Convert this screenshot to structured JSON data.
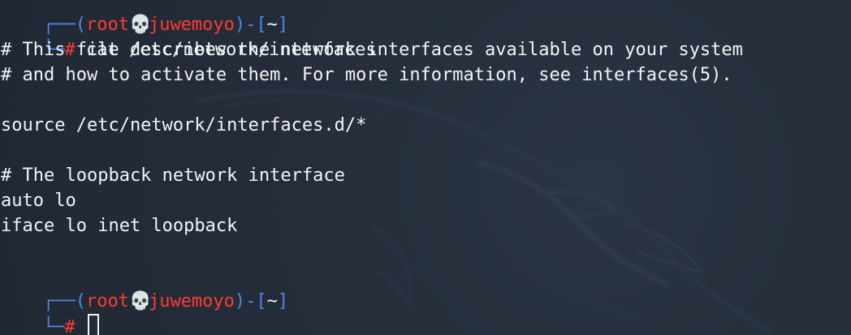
{
  "terminal": {
    "prompt_user": "root",
    "prompt_skull": "💀",
    "prompt_host": "juwemoyo",
    "prompt_path": "~",
    "prompt_hash": "#",
    "prompt_open": "┌──(",
    "prompt_close": ")-[",
    "prompt_end": "]",
    "prompt_corner_bottom": "└─",
    "command": "cat /etc/network/interfaces",
    "lines": [
      "# This file describes the network interfaces available on your system",
      "# and how to activate them. For more information, see interfaces(5).",
      "",
      "source /etc/network/interfaces.d/*",
      "",
      "# The loopback network interface",
      "auto lo",
      "iface lo inet loopback"
    ]
  },
  "colors": {
    "background": "#252d3a",
    "foreground": "#f2f4f8",
    "accent_blue": "#4d86e8",
    "accent_red": "#ff3b30"
  },
  "icons": {
    "skull": "skull-icon",
    "cursor": "terminal-cursor-icon"
  }
}
